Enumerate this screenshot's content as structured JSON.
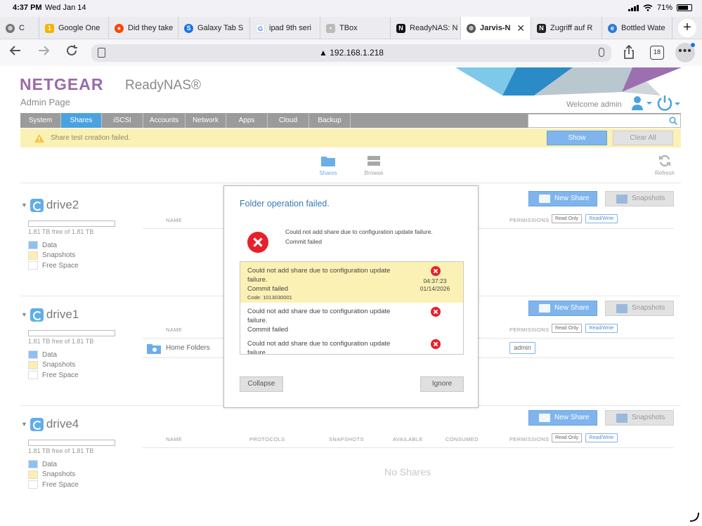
{
  "status_bar": {
    "time": "4:37 PM",
    "date": "Wed Jan 14",
    "battery": "71%"
  },
  "browser": {
    "tabs": [
      {
        "title": "C",
        "icon": "globe-icon",
        "favicon_color": "#777777"
      },
      {
        "title": "Google One",
        "icon": "google-one-icon",
        "favicon_color": "#f4b400"
      },
      {
        "title": "Did they take",
        "icon": "reddit-icon",
        "favicon_color": "#ff4500"
      },
      {
        "title": "Galaxy Tab S",
        "icon": "samsung-icon",
        "favicon_color": "#1a73e8"
      },
      {
        "title": "ipad 9th seri",
        "icon": "google-icon",
        "favicon_color": "#4285f4"
      },
      {
        "title": "TBox",
        "icon": "image-icon",
        "favicon_color": "#888888"
      },
      {
        "title": "ReadyNAS: N",
        "icon": "netgear-icon",
        "favicon_color": "#111111"
      },
      {
        "title": "Jarvis-N",
        "icon": "globe-icon",
        "favicon_color": "#555555",
        "active": true
      },
      {
        "title": "Zugriff auf R",
        "icon": "notion-icon",
        "favicon_color": "#222222"
      },
      {
        "title": "Bottled Wate",
        "icon": "edge-icon",
        "favicon_color": "#2e7bd6"
      }
    ],
    "url": "192.168.1.218",
    "tab_count": "18"
  },
  "nas": {
    "brand": "NETGEAR",
    "product": "ReadyNAS®",
    "admin_page": "Admin Page",
    "welcome": "Welcome admin",
    "nav": [
      "System",
      "Shares",
      "iSCSI",
      "Accounts",
      "Network",
      "Apps",
      "Cloud",
      "Backup"
    ],
    "active_nav": "Shares",
    "alert": "Share test creation failed.",
    "show_label": "Show",
    "clear_all_label": "Clear All",
    "subnav": {
      "shares": "Shares",
      "browse": "Browse",
      "refresh": "Refresh"
    },
    "columns": {
      "name": "NAME",
      "protocols": "PROTOCOLS",
      "snapshots": "SNAPSHOTS",
      "available": "AVAILABLE",
      "consumed": "CONSUMED",
      "permissions": "PERMISSIONS"
    },
    "perm_buttons": {
      "read_only": "Read Only",
      "read_write": "Read/Write"
    },
    "new_share_label": "New Share",
    "snapshots_label": "Snapshots",
    "legend": {
      "data": "Data",
      "snapshots": "Snapshots",
      "free": "Free Space"
    },
    "legend_colors": {
      "data": "#8ec0f0",
      "snapshots": "#fcefb0",
      "free": "#ffffff"
    },
    "volumes": [
      {
        "name": "drive2",
        "free_text": "1.81 TB free of 1.81 TB"
      },
      {
        "name": "drive1",
        "free_text": "1.81 TB free of 1.81 TB",
        "share": "Home Folders",
        "share_perm": "admin"
      },
      {
        "name": "drive4",
        "free_text": "1.81 TB free of 1.81 TB",
        "empty": "No Shares"
      }
    ]
  },
  "modal": {
    "title": "Folder operation failed.",
    "summary_line1": "Could not add share due to configuration update failure.",
    "summary_line2": "Commit failed",
    "errors": [
      {
        "line1": "Could not add share due to configuration update",
        "line2": "failure.",
        "line3": "Commit failed",
        "code": "Code: 1013030001",
        "time": "04:37:23",
        "date": "01/14/2026"
      },
      {
        "line1": "Could not add share due to configuration update",
        "line2": "failure.",
        "line3": "Commit failed"
      },
      {
        "line1": "Could not add share due to configuration update",
        "line2": "failure."
      }
    ],
    "collapse_label": "Collapse",
    "ignore_label": "Ignore"
  }
}
